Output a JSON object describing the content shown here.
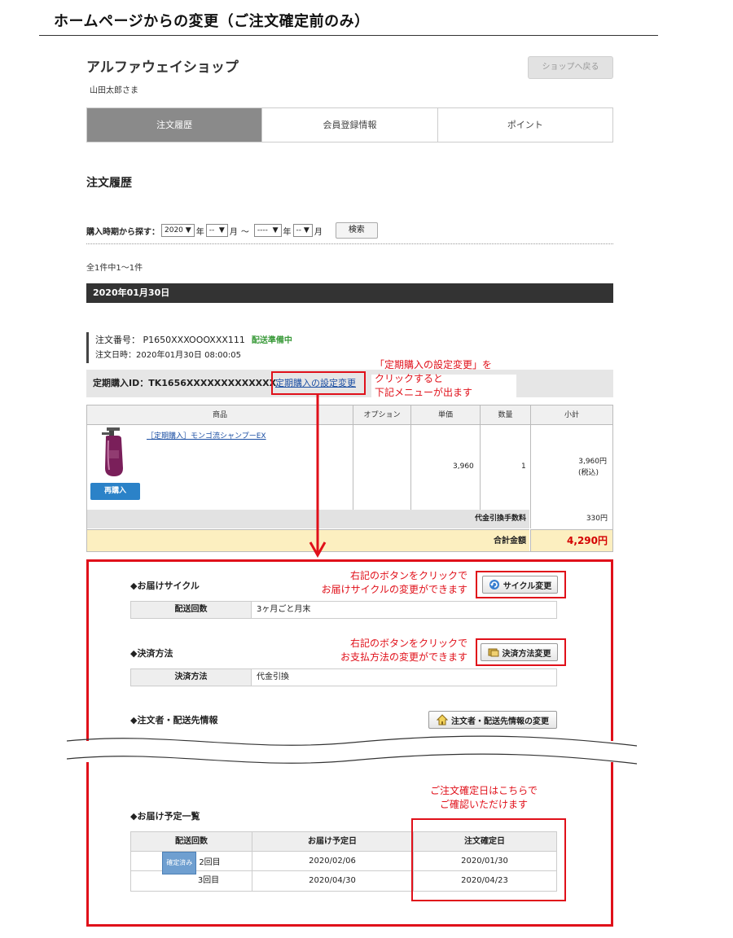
{
  "doc": {
    "title": "ホームページからの変更（ご注文確定前のみ）"
  },
  "shop": {
    "name": "アルファウェイショップ",
    "user": "山田太郎さま",
    "back_button": "ショップへ戻る"
  },
  "tabs": [
    {
      "label": "注文履歴",
      "active": true
    },
    {
      "label": "会員登録情報",
      "active": false
    },
    {
      "label": "ポイント",
      "active": false
    }
  ],
  "page_title": "注文履歴",
  "search": {
    "label": "購入時期から探す：",
    "year": "2020",
    "month": "--",
    "year2": "----",
    "month2": "--",
    "unit_year": "年",
    "unit_month": "月",
    "tilde": "〜",
    "button": "検索"
  },
  "result_count": "全1件中1〜1件",
  "order": {
    "date": "2020年01月30日",
    "number_label": "注文番号：",
    "number": "P1650XXXOOOXXX111",
    "status": "配送準備中",
    "datetime_label": "注文日時：",
    "datetime": "2020年01月30日 08:00:05",
    "subscription_label": "定期購入ID：",
    "subscription_id": "TK1656XXXXXXXXXXXXX",
    "subscription_link": "定期購入の設定変更"
  },
  "items_table": {
    "headers": [
      "商品",
      "オプション",
      "単価",
      "数量",
      "小計"
    ],
    "rows": [
      {
        "product": "［定期購入］モンゴ流シャンプーEX",
        "option": "",
        "unit_price": "3,960",
        "qty": "1",
        "subtotal": "3,960円",
        "tax_note": "(税込)",
        "rebuy": "再購入"
      }
    ],
    "fee_label": "代金引換手数料",
    "fee_value": "330円",
    "total_label": "合計金額",
    "total_value": "4,290円"
  },
  "annotations": {
    "link_note": [
      "「定期購入の設定変更」を",
      "クリックすると",
      "下記メニューが出ます"
    ],
    "cycle_note": [
      "右記のボタンをクリックで",
      "お届けサイクルの変更ができます"
    ],
    "payment_note": [
      "右記のボタンをクリックで",
      "お支払方法の変更ができます"
    ],
    "confirm_note": [
      "ご注文確定日はこちらで",
      "ご確認いただけます"
    ]
  },
  "menu": {
    "cycle": {
      "heading": "◆お届けサイクル",
      "button": "サイクル変更",
      "key": "配送回数",
      "value": "3ヶ月ごと月末"
    },
    "payment": {
      "heading": "◆決済方法",
      "button": "決済方法変更",
      "key": "決済方法",
      "value": "代金引換"
    },
    "address": {
      "heading": "◆注文者・配送先情報",
      "button": "注文者・配送先情報の変更"
    },
    "schedule": {
      "heading": "◆お届け予定一覧",
      "headers": [
        "配送回数",
        "お届け予定日",
        "注文確定日"
      ],
      "rows": [
        {
          "badge": "確定済み",
          "count": "2回目",
          "delivery": "2020/02/06",
          "confirm": "2020/01/30"
        },
        {
          "badge": "",
          "count": "3回目",
          "delivery": "2020/04/30",
          "confirm": "2020/04/23"
        }
      ]
    }
  },
  "colors": {
    "annotation_red": "#e0101a",
    "link_blue": "#1a4ea3",
    "status_green": "#3a9a3a",
    "total_bg": "#fcefc0",
    "total_red": "#d40000",
    "rebuy_blue": "#2b82c8"
  }
}
